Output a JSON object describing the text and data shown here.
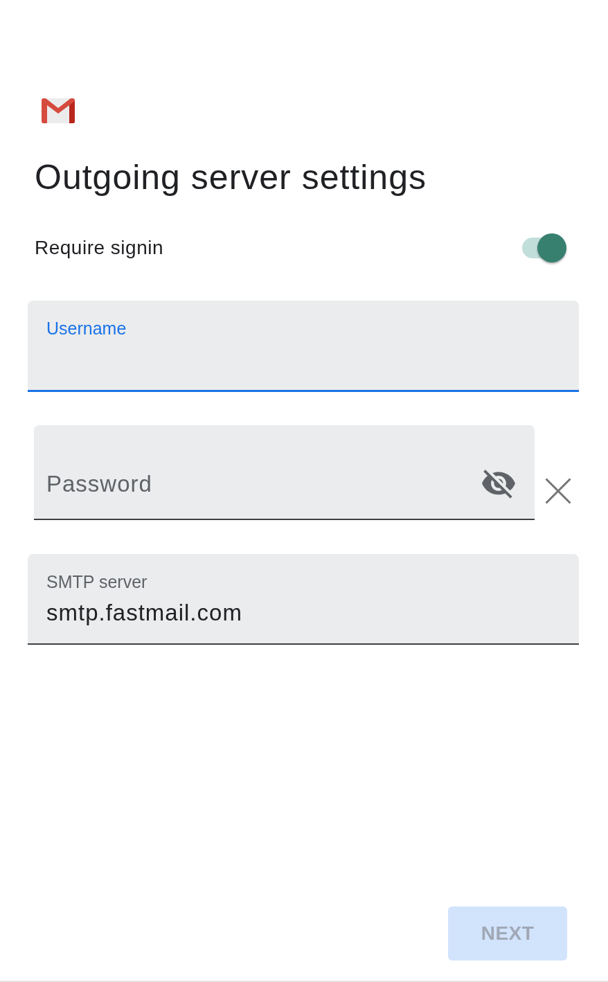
{
  "app": {
    "title": "Outgoing server settings"
  },
  "require_signin": {
    "label": "Require signin",
    "on": true
  },
  "fields": [
    {
      "kind": "filled",
      "label": "Username",
      "focused": true
    },
    {
      "kind": "password",
      "placeholder": "Password",
      "visible": false
    },
    {
      "kind": "filled",
      "label": "SMTP server",
      "value": "smtp.fastmail.com",
      "focused": false
    }
  ],
  "next_button": {
    "label": "NEXT",
    "disabled": true
  }
}
